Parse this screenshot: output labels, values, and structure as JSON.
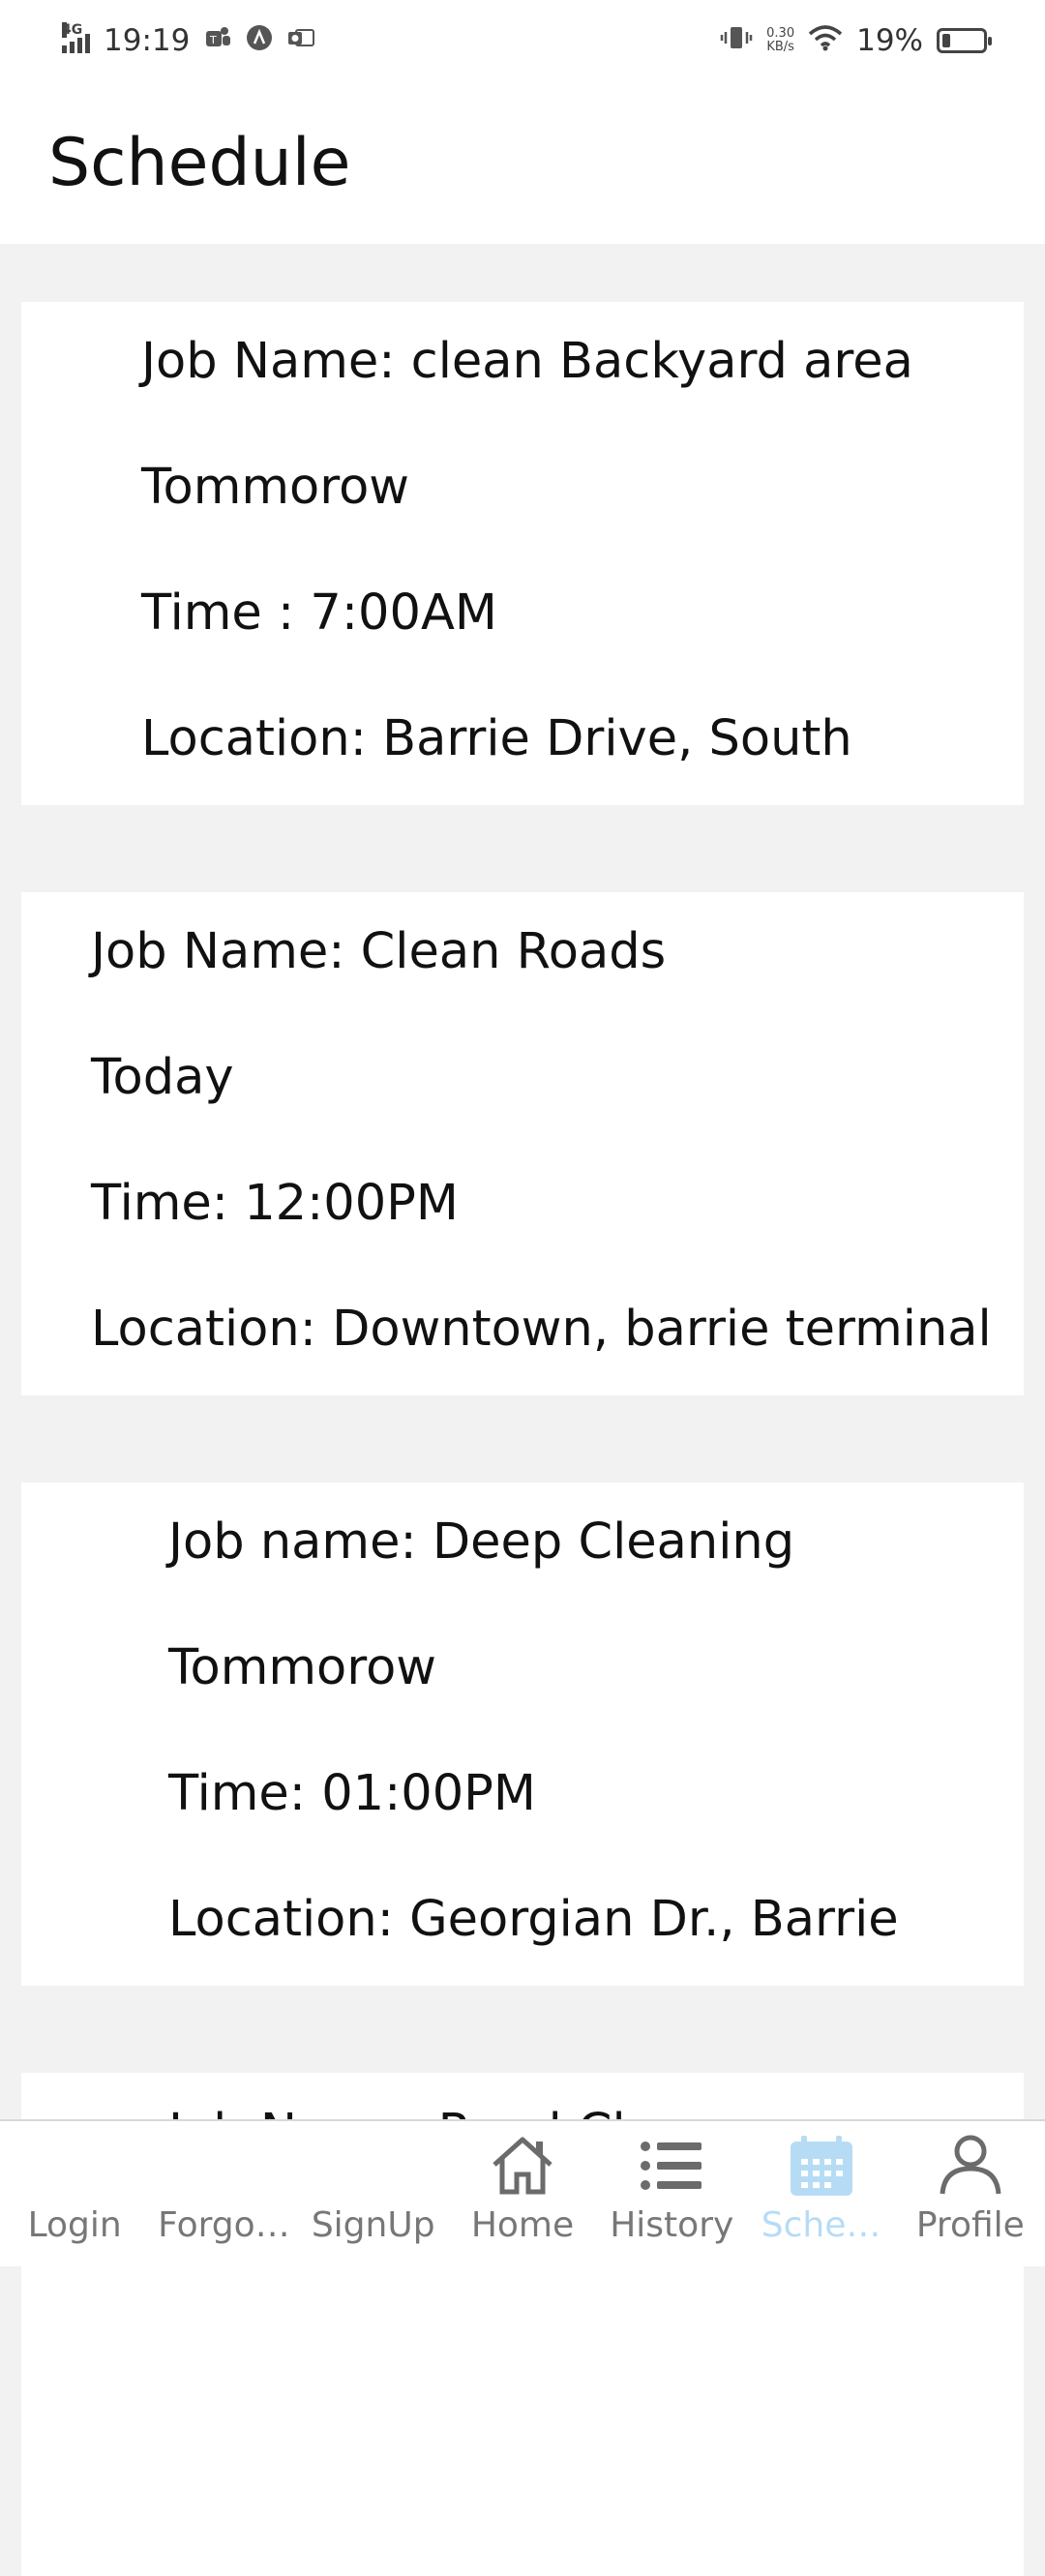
{
  "status_bar": {
    "network": "4G",
    "time": "19:19",
    "speed_value": "0.30",
    "speed_unit": "KB/s",
    "battery": "19%",
    "battery_fraction": 0.19
  },
  "header": {
    "title": "Schedule"
  },
  "jobs": [
    {
      "name": "Job Name: clean Backyard area",
      "day": "Tommorow",
      "time": "Time : 7:00AM",
      "location": "Location: Barrie Drive, South"
    },
    {
      "name": "Job Name: Clean Roads",
      "day": "Today",
      "time": "Time: 12:00PM",
      "location": "Location: Downtown, barrie terminal"
    },
    {
      "name": "Job name: Deep Cleaning",
      "day": "Tommorow",
      "time": "Time: 01:00PM",
      "location": "Location: Georgian Dr., Barrie"
    },
    {
      "name": "Job Name: Road Cl..."
    }
  ],
  "nav": {
    "items": [
      {
        "label": "Login"
      },
      {
        "label": "Forgo…"
      },
      {
        "label": "SignUp"
      },
      {
        "label": "Home",
        "icon": "home-icon"
      },
      {
        "label": "History",
        "icon": "list-icon"
      },
      {
        "label": "Sche…",
        "icon": "calendar-icon",
        "active": true
      },
      {
        "label": "Profile",
        "icon": "person-icon"
      }
    ],
    "active_color": "#b6dcf5",
    "inactive_color": "#777777"
  }
}
